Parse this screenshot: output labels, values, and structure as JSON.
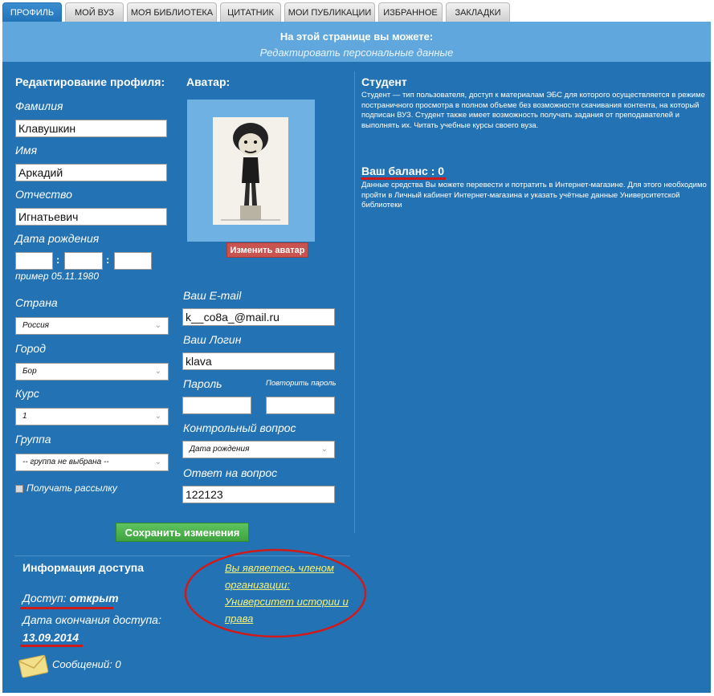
{
  "tabs": [
    "ПРОФИЛЬ",
    "МОЙ ВУЗ",
    "МОЯ БИБЛИОТЕКА",
    "ЦИТАТНИК",
    "МОИ ПУБЛИКАЦИИ",
    "ИЗБРАННОЕ",
    "ЗАКЛАДКИ"
  ],
  "active_tab": "ПРОФИЛЬ",
  "header": {
    "title": "На этой странице вы можете:",
    "subtitle": "Редактировать персональные данные"
  },
  "profile": {
    "title": "Редактирование профиля:",
    "surname_label": "Фамилия",
    "surname": "Клавушкин",
    "name_label": "Имя",
    "name": "Аркадий",
    "patronymic_label": "Отчество",
    "patronymic": "Игнатьевич",
    "birth_label": "Дата рождения",
    "birth_sep": ":",
    "birth_example": "пример 05.11.1980",
    "country_label": "Страна",
    "country": "Россия",
    "city_label": "Город",
    "city": "Бор",
    "course_label": "Курс",
    "course": "1",
    "group_label": "Группа",
    "group": "-- группа не выбрана --",
    "newsletter_label": "Получать рассылку"
  },
  "avatar": {
    "title": "Аватар:",
    "change_button": "Изменить аватар"
  },
  "account": {
    "email_label": "Ваш E-mail",
    "email": "k__co8a_@mail.ru",
    "login_label": "Ваш Логин",
    "login": "klava",
    "password_label": "Пароль",
    "password_repeat_label": "Повторить пароль",
    "question_label": "Контрольный вопрос",
    "question": "Дата рождения",
    "answer_label": "Ответ на вопрос",
    "answer": "122123"
  },
  "save_button": "Сохранить изменения",
  "student": {
    "title": "Студент",
    "text": "Студент — тип пользователя, доступ к материалам ЭБС для которого осуществляется в режиме постраничного просмотра в полном объеме без возможности скачивания контента, на который подписан ВУЗ. Студент также имеет возможность получать задания от преподавателей и выполнять их. Читать учебные курсы своего вуза.",
    "balance_title": "Ваш баланс : 0",
    "balance_text": "Данные средства Вы можете перевести и потратить в Интернет-магазине. Для этого необходимо пройти в Личный кабинет Интернет-магазина и указать учётные данные Университетской библиотеки"
  },
  "access": {
    "title": "Информация доступа",
    "status_label": "Доступ:",
    "status": "открыт",
    "end_label": "Дата окончания доступа:",
    "end_date": "13.09.2014",
    "messages_label": "Сообщений:",
    "messages": "0",
    "org_line1": "Вы являетесь членом",
    "org_line2": "организации:",
    "org_line3": "Университет истории и",
    "org_line4": "права"
  },
  "colors": {
    "panel": "#2373b4",
    "header": "#5fa7dc",
    "annotation": "#d01a1a",
    "link": "#f7f27a"
  }
}
